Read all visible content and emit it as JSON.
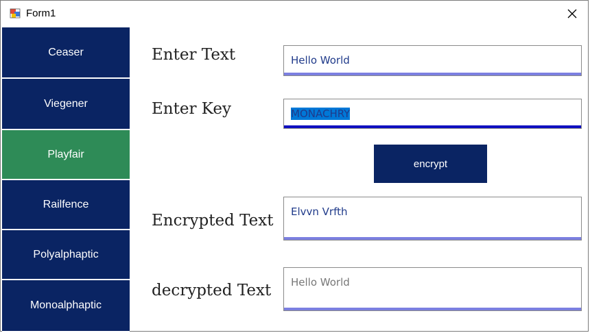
{
  "window": {
    "title": "Form1"
  },
  "sidebar": {
    "items": [
      {
        "label": "Ceaser"
      },
      {
        "label": "Viegener"
      },
      {
        "label": "Playfair"
      },
      {
        "label": "Railfence"
      },
      {
        "label": "Polyalphaptic"
      },
      {
        "label": "Monoalphaptic"
      }
    ],
    "selected": "Playfair"
  },
  "main": {
    "enter_text_label": "Enter Text",
    "enter_text_value": "Hello World",
    "enter_key_label": "Enter Key",
    "enter_key_value": "MONACHRY",
    "encrypt_button": "encrypt",
    "encrypted_label": "Encrypted Text",
    "encrypted_value": "Elvvn Vrfth",
    "decrypted_label": "decrypted Text",
    "decrypted_value": "Hello World"
  },
  "colors": {
    "button_navy": "#0a2463",
    "active_green": "#2e8b57",
    "underline_light": "#7b7fe0",
    "underline_focused": "#1010c0"
  }
}
